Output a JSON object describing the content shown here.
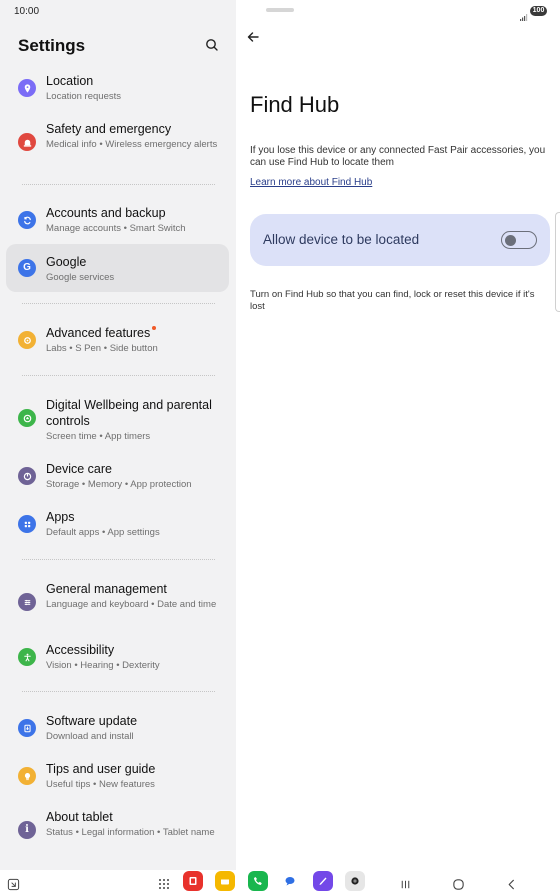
{
  "status_bar": {
    "time": "10:00",
    "battery": "100"
  },
  "sidebar": {
    "title": "Settings",
    "items": [
      {
        "title": "Location",
        "subtitle": "Location requests",
        "icon": "location-icon",
        "color": "#7b6cf6"
      },
      {
        "title": "Safety and emergency",
        "subtitle": "Medical info  •  Wireless emergency alerts",
        "icon": "emergency-icon",
        "color": "#e0483f"
      },
      {
        "title": "Accounts and backup",
        "subtitle": "Manage accounts  •  Smart Switch",
        "icon": "sync-icon",
        "color": "#3d74e8"
      },
      {
        "title": "Google",
        "subtitle": "Google services",
        "icon": "google-icon",
        "color": "#3d74e8"
      },
      {
        "title": "Advanced features",
        "subtitle": "Labs  •  S Pen  •  Side button",
        "icon": "gear-plus-icon",
        "color": "#f2b134"
      },
      {
        "title": "Digital Wellbeing and parental controls",
        "subtitle": "Screen time  •  App timers",
        "icon": "wellbeing-icon",
        "color": "#3db54a"
      },
      {
        "title": "Device care",
        "subtitle": "Storage  •  Memory  •  App protection",
        "icon": "device-care-icon",
        "color": "#6f6396"
      },
      {
        "title": "Apps",
        "subtitle": "Default apps  •  App settings",
        "icon": "apps-icon",
        "color": "#3d74e8"
      },
      {
        "title": "General management",
        "subtitle": "Language and keyboard  •  Date and time",
        "icon": "sliders-icon",
        "color": "#6f6396"
      },
      {
        "title": "Accessibility",
        "subtitle": "Vision  •  Hearing  •  Dexterity",
        "icon": "accessibility-icon",
        "color": "#3db54a"
      },
      {
        "title": "Software update",
        "subtitle": "Download and install",
        "icon": "update-icon",
        "color": "#3d74e8"
      },
      {
        "title": "Tips and user guide",
        "subtitle": "Useful tips  •  New features",
        "icon": "lightbulb-icon",
        "color": "#f2b134"
      },
      {
        "title": "About tablet",
        "subtitle": "Status  •  Legal information  •  Tablet name",
        "icon": "info-icon",
        "color": "#6f6396"
      }
    ]
  },
  "main": {
    "title": "Find Hub",
    "description": "If you lose this device or any connected Fast Pair accessories, you can use Find Hub to locate them",
    "learn_more": "Learn more about Find Hub",
    "toggle_label": "Allow device to be located",
    "toggle_on": false,
    "note": "Turn on Find Hub so that you can find, lock or reset this device if it's lost"
  },
  "taskbar": {
    "apps": [
      "app-drawer-icon",
      "flipboard-icon",
      "notes-icon",
      "phone-icon",
      "messages-icon",
      "galaxy-store-icon",
      "camera-icon"
    ]
  }
}
